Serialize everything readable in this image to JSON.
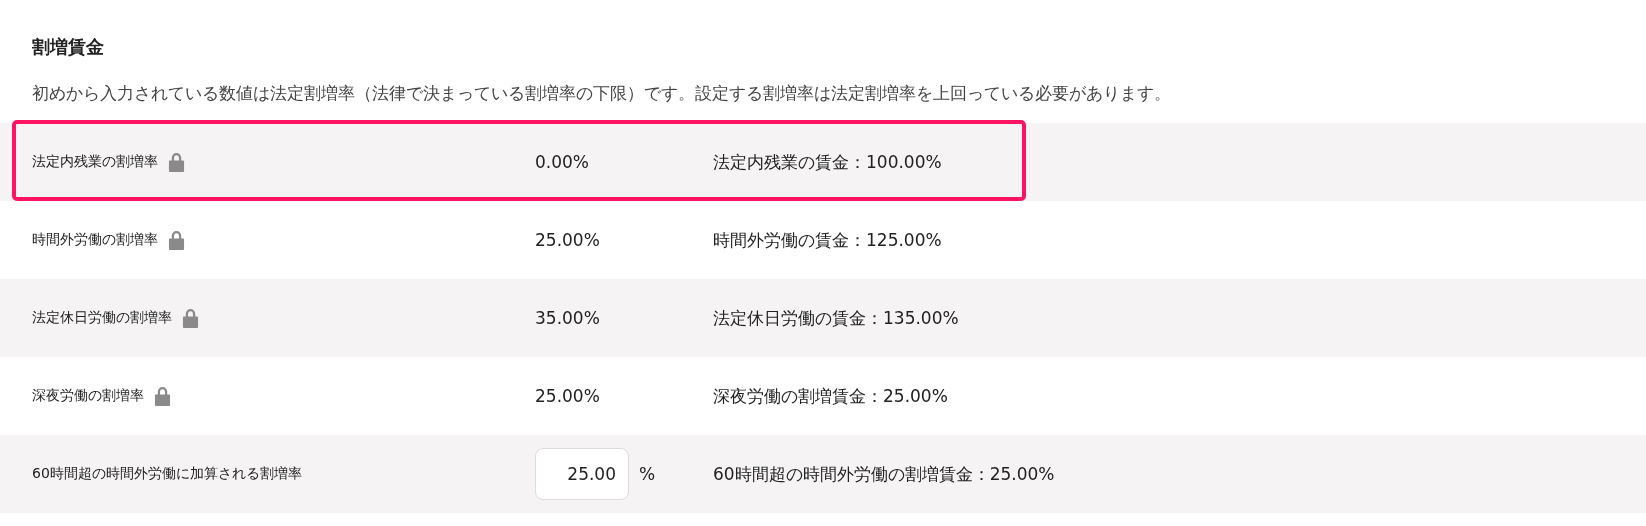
{
  "section": {
    "title": "割増賃金",
    "description": "初めから入力されている数値は法定割増率（法律で決まっている割増率の下限）です。設定する割増率は法定割増率を上回っている必要があります。"
  },
  "rows": [
    {
      "kind": "locked",
      "label": "法定内残業の割増率",
      "value": "0.00%",
      "wage": "法定内残業の賃金：100.00%",
      "highlighted": true
    },
    {
      "kind": "locked",
      "label": "時間外労働の割増率",
      "value": "25.00%",
      "wage": "時間外労働の賃金：125.00%",
      "highlighted": false
    },
    {
      "kind": "locked",
      "label": "法定休日労働の割増率",
      "value": "35.00%",
      "wage": "法定休日労働の賃金：135.00%",
      "highlighted": false
    },
    {
      "kind": "locked",
      "label": "深夜労働の割増率",
      "value": "25.00%",
      "wage": "深夜労働の割増賃金：25.00%",
      "highlighted": false
    },
    {
      "kind": "input",
      "label": "60時間超の時間外労働に加算される割増率",
      "value": "25.00",
      "unit": "%",
      "wage": "60時間超の時間外労働の割増賃金：25.00%",
      "highlighted": false
    }
  ]
}
